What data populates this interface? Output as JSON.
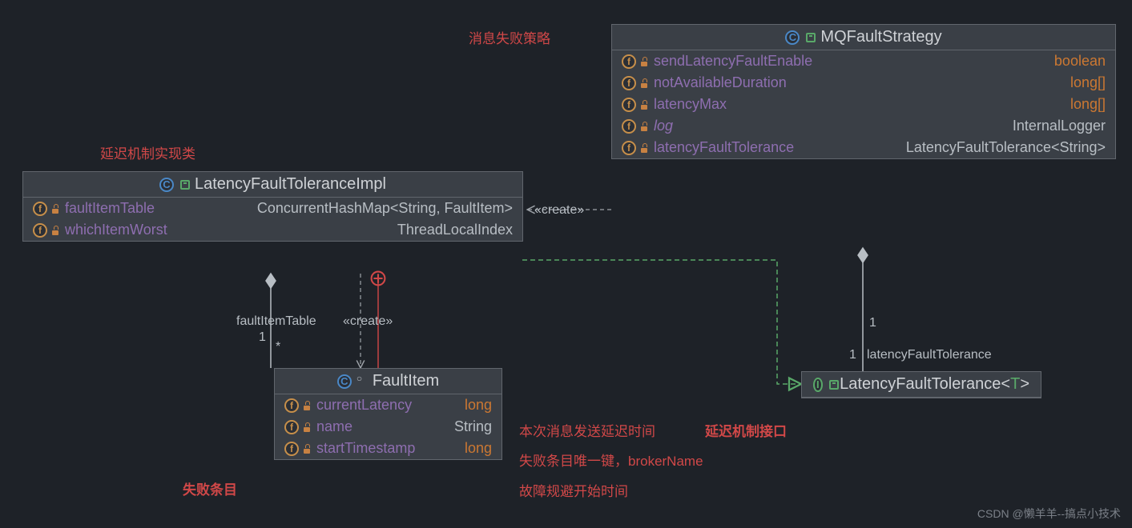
{
  "annotations": {
    "msg_fail_strategy": "消息失败策略",
    "latency_impl_note": "延迟机制实现类",
    "fault_item_note": "失败条目",
    "current_latency_note": "本次消息发送延迟时间",
    "name_note": "失败条目唯一键，brokerName",
    "start_ts_note": "故障规避开始时间",
    "latency_iface_note": "延迟机制接口"
  },
  "mq": {
    "title": "MQFaultStrategy",
    "members": [
      {
        "name": "sendLatencyFaultEnable",
        "type": "boolean",
        "keyword": true
      },
      {
        "name": "notAvailableDuration",
        "type": "long[]",
        "keyword": true
      },
      {
        "name": "latencyMax",
        "type": "long[]",
        "keyword": true
      },
      {
        "name": "log",
        "type": "InternalLogger",
        "italic": true
      },
      {
        "name": "latencyFaultTolerance",
        "type": "LatencyFaultTolerance<String>"
      }
    ]
  },
  "impl": {
    "title": "LatencyFaultToleranceImpl",
    "members": [
      {
        "name": "faultItemTable",
        "type": "ConcurrentHashMap<String, FaultItem>"
      },
      {
        "name": "whichItemWorst",
        "type": "ThreadLocalIndex"
      }
    ]
  },
  "fault_item": {
    "title": "FaultItem",
    "members": [
      {
        "name": "currentLatency",
        "type": "long",
        "keyword": true
      },
      {
        "name": "name",
        "type": "String"
      },
      {
        "name": "startTimestamp",
        "type": "long",
        "keyword": true
      }
    ]
  },
  "iface": {
    "title_pre": "LatencyFaultTolerance<",
    "title_param": "T",
    "title_post": ">"
  },
  "edges": {
    "create1": "«create»",
    "create2": "«create»",
    "faultItemTable": "faultItemTable",
    "one_a": "1",
    "star": "*",
    "one_b": "1",
    "one_c": "1",
    "lft_label": "latencyFaultTolerance"
  },
  "watermark": "CSDN @懒羊羊--搞点小技术"
}
